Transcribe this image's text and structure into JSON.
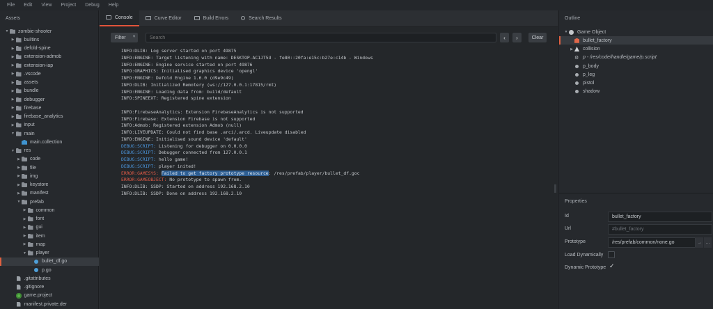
{
  "menubar": [
    "File",
    "Edit",
    "View",
    "Project",
    "Debug",
    "Help"
  ],
  "assets": {
    "title": "Assets",
    "items": [
      {
        "label": "zombie-shooter",
        "type": "folder",
        "depth": 0,
        "open": true
      },
      {
        "label": "builtins",
        "type": "folder",
        "depth": 1
      },
      {
        "label": "defold-spine",
        "type": "folder",
        "depth": 1
      },
      {
        "label": "extension-admob",
        "type": "folder",
        "depth": 1
      },
      {
        "label": "extension-iap",
        "type": "folder",
        "depth": 1
      },
      {
        "label": ".vscode",
        "type": "folder",
        "depth": 1
      },
      {
        "label": "assets",
        "type": "folder",
        "depth": 1
      },
      {
        "label": "bundle",
        "type": "folder",
        "depth": 1
      },
      {
        "label": "debugger",
        "type": "folder",
        "depth": 1
      },
      {
        "label": "firebase",
        "type": "folder",
        "depth": 1
      },
      {
        "label": "firebase_analytics",
        "type": "folder",
        "depth": 1
      },
      {
        "label": "input",
        "type": "folder",
        "depth": 1
      },
      {
        "label": "main",
        "type": "folder",
        "depth": 1,
        "open": true
      },
      {
        "label": "main.collection",
        "type": "collection",
        "depth": 2
      },
      {
        "label": "res",
        "type": "folder",
        "depth": 1,
        "open": true
      },
      {
        "label": "code",
        "type": "folder",
        "depth": 2
      },
      {
        "label": "file",
        "type": "folder",
        "depth": 2
      },
      {
        "label": "img",
        "type": "folder",
        "depth": 2
      },
      {
        "label": "keystore",
        "type": "folder",
        "depth": 2
      },
      {
        "label": "manifest",
        "type": "folder",
        "depth": 2
      },
      {
        "label": "prefab",
        "type": "folder",
        "depth": 2,
        "open": true
      },
      {
        "label": "common",
        "type": "folder",
        "depth": 3
      },
      {
        "label": "font",
        "type": "folder",
        "depth": 3
      },
      {
        "label": "gui",
        "type": "folder",
        "depth": 3
      },
      {
        "label": "item",
        "type": "folder",
        "depth": 3
      },
      {
        "label": "map",
        "type": "folder",
        "depth": 3
      },
      {
        "label": "player",
        "type": "folder",
        "depth": 3,
        "open": true
      },
      {
        "label": "bullet_df.go",
        "type": "go",
        "depth": 4,
        "selected": true
      },
      {
        "label": "p.go",
        "type": "go",
        "depth": 4
      },
      {
        "label": ".gitattributes",
        "type": "file",
        "depth": 1
      },
      {
        "label": ".gitignore",
        "type": "file",
        "depth": 1
      },
      {
        "label": "game.project",
        "type": "project",
        "depth": 1
      },
      {
        "label": "manifest.private.der",
        "type": "file",
        "depth": 1
      }
    ]
  },
  "tabs": [
    {
      "label": "Console",
      "active": true
    },
    {
      "label": "Curve Editor"
    },
    {
      "label": "Build Errors"
    },
    {
      "label": "Search Results"
    }
  ],
  "toolbar": {
    "filter_label": "Filter",
    "search_placeholder": "Search",
    "prev_label": "‹",
    "next_label": "›",
    "clear_label": "Clear"
  },
  "console": [
    {
      "text": "INFO:DLIB: Log server started on port 49875",
      "kind": "info"
    },
    {
      "text": "INFO:ENGINE: Target listening with name: DESKTOP-AC1JT5U - fe80::20fa:e15c:b27e:c14b - Windows",
      "kind": "info"
    },
    {
      "text": "INFO:ENGINE: Engine service started on port 49876",
      "kind": "info"
    },
    {
      "text": "INFO:GRAPHICS: Initialised graphics device 'opengl'",
      "kind": "info"
    },
    {
      "text": "INFO:ENGINE: Defold Engine 1.6.0 (d9e9c49)",
      "kind": "info"
    },
    {
      "text": "INFO:DLIB: Initialized Remotery (ws://127.0.0.1:17815/rmt)",
      "kind": "info"
    },
    {
      "text": "INFO:ENGINE: Loading data from: build/default",
      "kind": "info"
    },
    {
      "text": "INFO:SPINEEXT: Registered spine extension",
      "kind": "info"
    },
    {
      "text": "",
      "kind": "blank"
    },
    {
      "text": "INFO:FirebaseAnalytics: Extension FirebaseAnalytics is not supported",
      "kind": "info"
    },
    {
      "text": "INFO:Firebase: Extension Firebase is not supported",
      "kind": "info"
    },
    {
      "text": "INFO:Admob: Registered extension Admob (null)",
      "kind": "info"
    },
    {
      "text": "INFO:LIVEUPDATE: Could not find base .arci/.arcd. Liveupdate disabled",
      "kind": "info"
    },
    {
      "text": "INFO:ENGINE: Initialised sound device 'default'",
      "kind": "info"
    },
    {
      "prefix": "DEBUG:SCRIPT:",
      "text": " Listening for debugger on 0.0.0.0",
      "kind": "debug"
    },
    {
      "prefix": "DEBUG:SCRIPT:",
      "text": " Debugger connected from 127.0.0.1",
      "kind": "debug"
    },
    {
      "prefix": "DEBUG:SCRIPT:",
      "text": " hello game!",
      "kind": "debug"
    },
    {
      "prefix": "DEBUG:SCRIPT:",
      "text": " player inited!",
      "kind": "debug"
    },
    {
      "prefix": "ERROR:GAMESYS:",
      "highlight": "Failed to get factory prototype resource",
      "text": ": /res/prefab/player/bullet_df.goc",
      "kind": "error"
    },
    {
      "prefix": "ERROR:GAMEOBJECT:",
      "text": " No prototype to spawn from.",
      "kind": "error"
    },
    {
      "text": "INFO:DLIB: SSDP: Started on address 192.168.2.10",
      "kind": "info"
    },
    {
      "text": "INFO:DLIB: SSDP: Done on address 192.168.2.10",
      "kind": "info"
    }
  ],
  "outline": {
    "title": "Outline",
    "items": [
      {
        "label": "Game Object",
        "icon": "game-object-icon",
        "depth": 0,
        "arrow": "▾"
      },
      {
        "label": "bullet_factory",
        "icon": "factory-icon",
        "depth": 1,
        "selected": true
      },
      {
        "label": "collision",
        "icon": "collision-icon",
        "depth": 1,
        "arrow": "▸"
      },
      {
        "label": "p - /res/code/handle/game/p.script",
        "icon": "script-icon",
        "depth": 1,
        "italic": true
      },
      {
        "label": "p_body",
        "icon": "sprite-icon",
        "depth": 1
      },
      {
        "label": "p_leg",
        "icon": "sprite-icon",
        "depth": 1
      },
      {
        "label": "pistol",
        "icon": "sprite-icon",
        "depth": 1
      },
      {
        "label": "shadow",
        "icon": "sprite-icon",
        "depth": 1
      }
    ]
  },
  "properties": {
    "title": "Properties",
    "id_label": "Id",
    "id_value": "bullet_factory",
    "url_label": "Url",
    "url_value": "#bullet_factory",
    "prototype_label": "Prototype",
    "prototype_value": "/res/prefab/common/none.go",
    "load_dynamically_label": "Load Dynamically",
    "load_dynamically": false,
    "dynamic_prototype_label": "Dynamic Prototype",
    "dynamic_prototype": true
  },
  "colors": {
    "accent": "#e2553c",
    "debug": "#4b96dd",
    "error": "#e05a46"
  }
}
